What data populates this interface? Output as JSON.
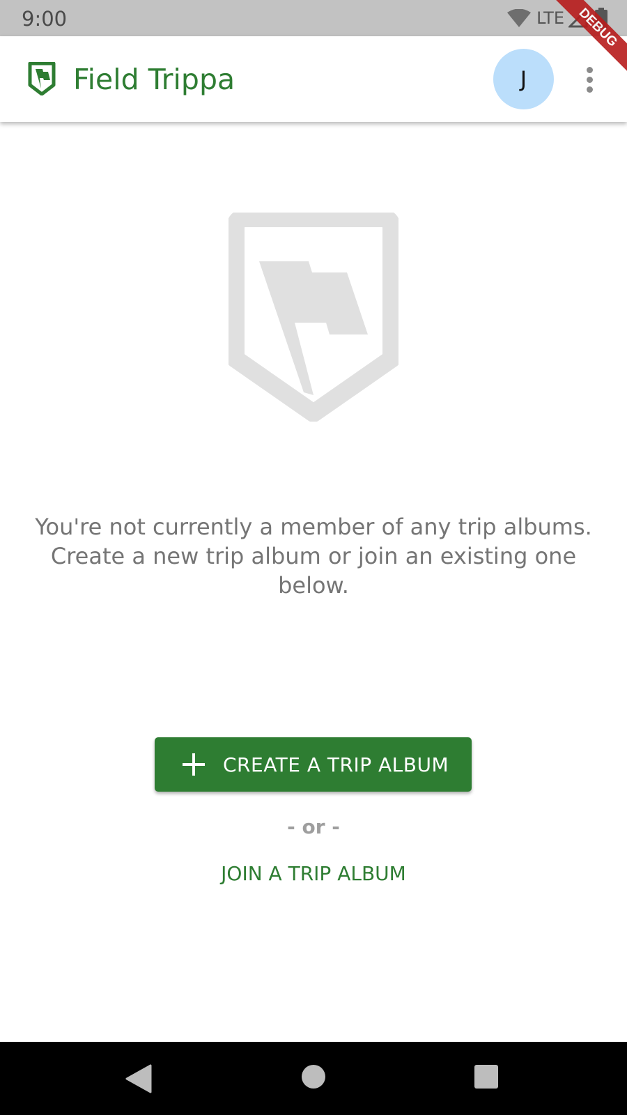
{
  "status_bar": {
    "time": "9:00",
    "network_label": "LTE",
    "icons": [
      "wifi-icon",
      "signal-icon",
      "battery-icon"
    ]
  },
  "debug_banner": "DEBUG",
  "app_bar": {
    "title": "Field Trippa",
    "logo_icon": "shield-flag-icon",
    "avatar_initial": "J",
    "menu_icon": "more-vert-icon"
  },
  "empty_state": {
    "illustration_icon": "shield-flag-icon",
    "message": "You're not currently a member of any trip albums. Create a new trip album or join an existing one below."
  },
  "actions": {
    "create_label": "CREATE A TRIP ALBUM",
    "create_icon": "plus-icon",
    "or_text": "- or -",
    "join_label": "JOIN A TRIP ALBUM"
  },
  "nav_bar": {
    "icons": [
      "back-icon",
      "home-icon",
      "recents-icon"
    ]
  },
  "colors": {
    "primary": "#2e7d32",
    "avatar_bg": "#bbdefb",
    "status_bar": "#c2c2c2",
    "illustration": "#e0e0e0",
    "debug": "#b71c1c"
  }
}
